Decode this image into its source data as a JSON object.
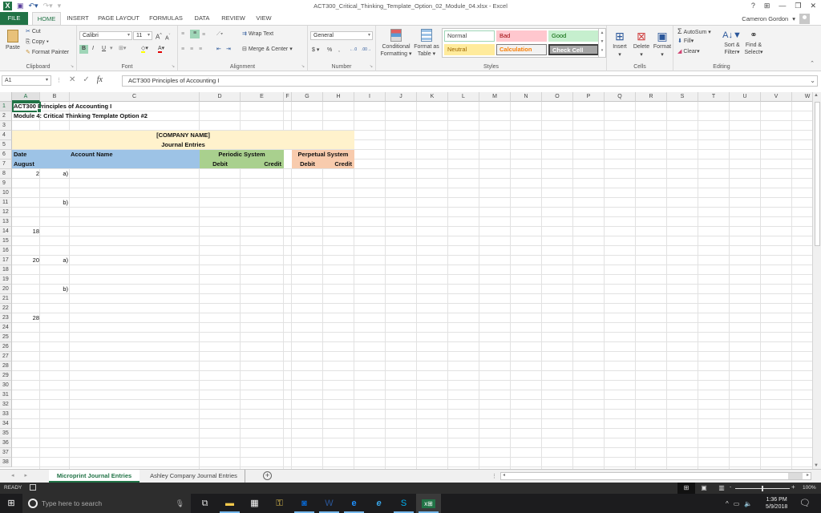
{
  "window": {
    "title": "ACT300_Critical_Thinking_Template_Option_02_Module_04.xlsx - Excel",
    "user": "Cameron Gordon",
    "controls": {
      "help": "?",
      "ribbon_display": "⊞",
      "minimize": "—",
      "restore": "❐",
      "close": "✕"
    }
  },
  "ribbon_tabs": [
    "FILE",
    "HOME",
    "INSERT",
    "PAGE LAYOUT",
    "FORMULAS",
    "DATA",
    "REVIEW",
    "VIEW"
  ],
  "active_ribbon_tab": "HOME",
  "ribbon": {
    "clipboard": {
      "label": "Clipboard",
      "paste": "Paste",
      "cut": "Cut",
      "copy": "Copy",
      "format_painter": "Format Painter"
    },
    "font": {
      "label": "Font",
      "font_name": "Calibri",
      "font_size": "11",
      "bold": "B",
      "italic": "I",
      "underline": "U"
    },
    "alignment": {
      "label": "Alignment",
      "wrap_text": "Wrap Text",
      "merge_center": "Merge & Center"
    },
    "number": {
      "label": "Number",
      "format": "General",
      "currency": "$",
      "percent": "%",
      "comma": ","
    },
    "styles": {
      "label": "Styles",
      "conditional_formatting": [
        "Conditional",
        "Formatting"
      ],
      "format_as_table": [
        "Format as",
        "Table"
      ],
      "cell_styles": [
        {
          "name": "Normal",
          "bg": "#ffffff",
          "color": "#000000"
        },
        {
          "name": "Bad",
          "bg": "#ffc7ce",
          "color": "#9c0006"
        },
        {
          "name": "Good",
          "bg": "#c6efce",
          "color": "#006100"
        },
        {
          "name": "Neutral",
          "bg": "#ffeb9c",
          "color": "#9c6500"
        },
        {
          "name": "Calculation",
          "bg": "#f2f2f2",
          "color": "#fa7d00"
        },
        {
          "name": "Check Cell",
          "bg": "#a5a5a5",
          "color": "#ffffff"
        }
      ]
    },
    "cells": {
      "label": "Cells",
      "insert": "Insert",
      "delete": "Delete",
      "format": "Format"
    },
    "editing": {
      "label": "Editing",
      "autosum": "AutoSum",
      "fill": "Fill",
      "clear": "Clear",
      "sort_filter": [
        "Sort &",
        "Filter"
      ],
      "find_select": [
        "Find &",
        "Select"
      ]
    }
  },
  "formula_bar": {
    "name_box": "A1",
    "content": "ACT300 Principles of Accounting I"
  },
  "sheet": {
    "columns": [
      "A",
      "B",
      "C",
      "D",
      "E",
      "F",
      "G",
      "H",
      "I",
      "J",
      "K",
      "L",
      "M",
      "N",
      "O",
      "P",
      "Q",
      "R",
      "S",
      "T",
      "U",
      "V",
      "W"
    ],
    "selected_column": "A",
    "selected_row": 1,
    "rows": [
      "1",
      "2",
      "3",
      "4",
      "5",
      "6",
      "7",
      "8",
      "9",
      "10",
      "11",
      "12",
      "13",
      "14",
      "15",
      "16",
      "17",
      "18",
      "19",
      "20",
      "21",
      "22",
      "23",
      "24",
      "25",
      "26",
      "27",
      "28",
      "29",
      "30",
      "31",
      "32",
      "33",
      "34",
      "35",
      "36",
      "37",
      "38"
    ],
    "title_line_1": "ACT300 Principles of Accounting I",
    "title_line_2": "Module 4: Critical Thinking Template Option #2",
    "company_name": "[COMPANY NAME]",
    "journal_entries": "Journal Entries",
    "headers": {
      "date": "Date",
      "month": "August",
      "account_name": "Account Name",
      "periodic_system": "Periodic System",
      "perpetual_system": "Perpetual System",
      "debit": "Debit",
      "credit": "Credit"
    },
    "entries": [
      {
        "row": 8,
        "date": "2",
        "part": "a)"
      },
      {
        "row": 11,
        "date": "",
        "part": "b)"
      },
      {
        "row": 14,
        "date": "18",
        "part": ""
      },
      {
        "row": 17,
        "date": "20",
        "part": "a)"
      },
      {
        "row": 20,
        "date": "",
        "part": "b)"
      },
      {
        "row": 23,
        "date": "28",
        "part": ""
      }
    ],
    "fill_colors": {
      "title_band": "#fff2cc",
      "account_band": "#9dc3e6",
      "periodic_band": "#a9d08e",
      "perpetual_band": "#f8cbad"
    }
  },
  "sheet_tabs": [
    {
      "name": "Microprint Journal Entries",
      "active": true
    },
    {
      "name": "Ashley Company Journal Entries",
      "active": false
    }
  ],
  "status_bar": {
    "mode": "READY",
    "zoom": "100%",
    "zoom_fraction": 0.5
  },
  "taskbar": {
    "search_placeholder": "Type here to search",
    "time": "1:36 PM",
    "date": "5/9/2018",
    "notifications": "1"
  }
}
